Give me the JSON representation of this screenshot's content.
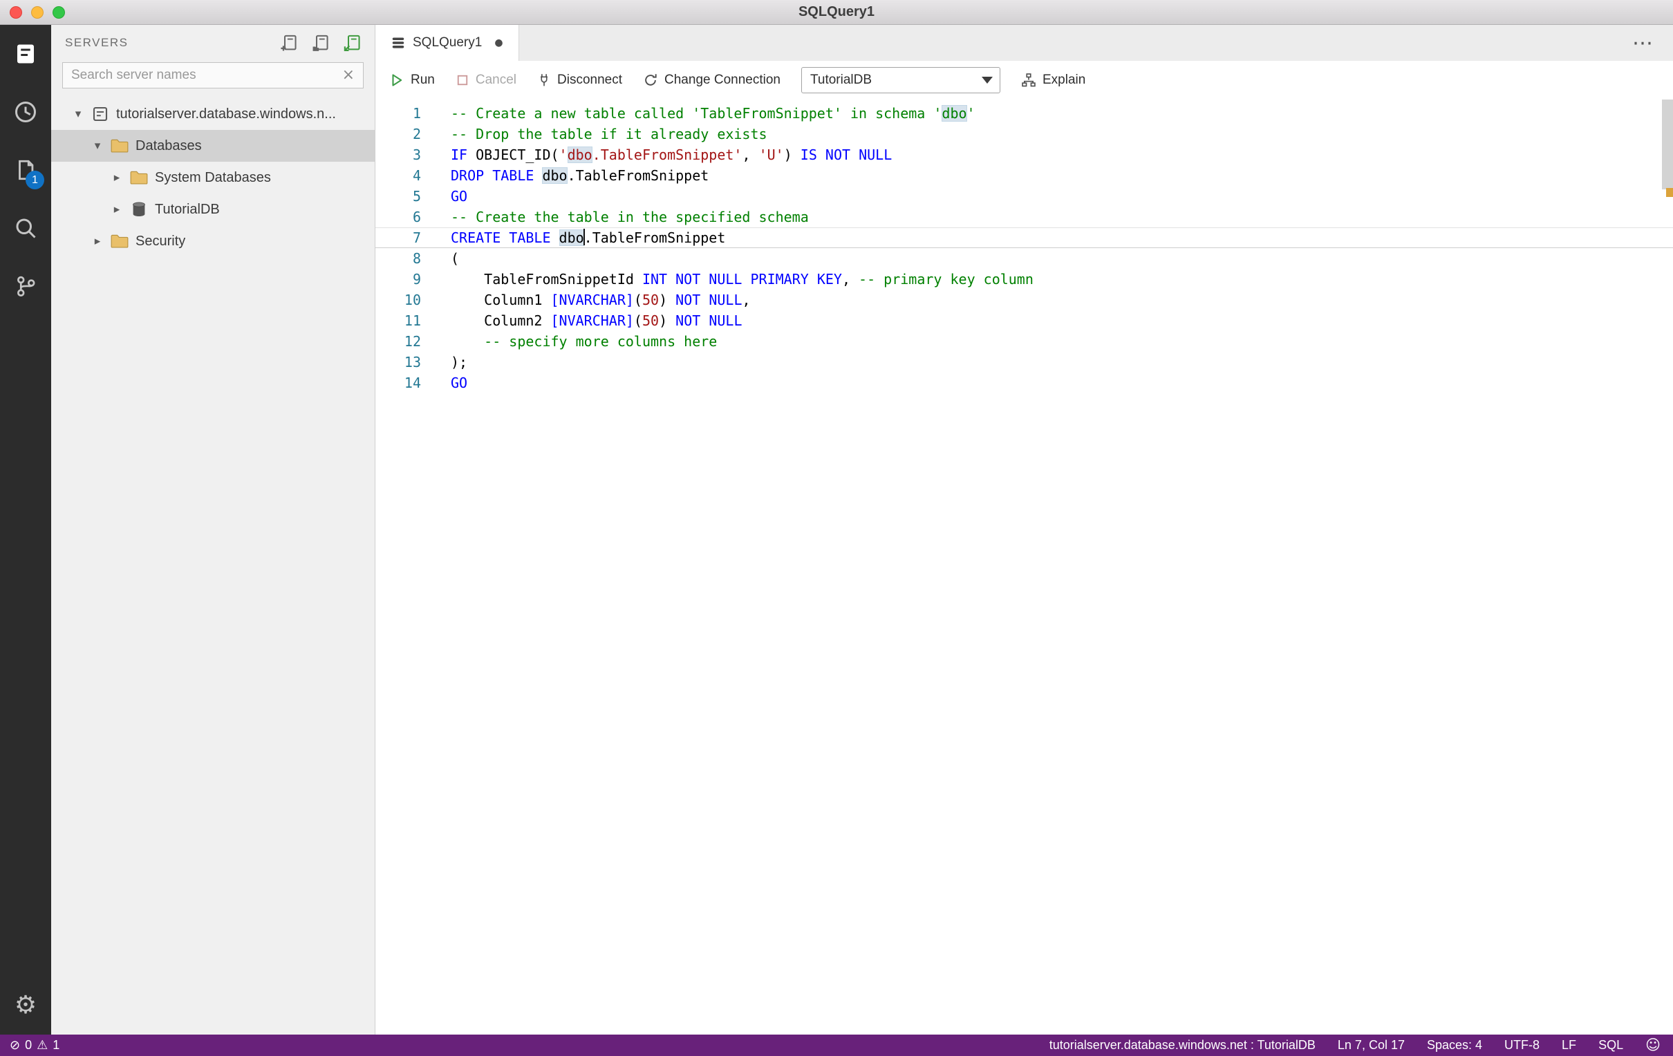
{
  "titlebar": {
    "title": "SQLQuery1"
  },
  "activity_bar": {
    "editors_badge": "1"
  },
  "icons": {
    "dirty_dot": "●",
    "more_actions": "⋯",
    "clear_search": "×",
    "error": "⊘",
    "warning": "⚠",
    "smiley": "☺",
    "gear": "⚙"
  },
  "sidebar": {
    "header": "SERVERS",
    "search_placeholder": "Search server names",
    "tree": [
      {
        "label": "tutorialserver.database.windows.n...",
        "level": 0,
        "state": "expanded",
        "icon": "server-icon",
        "selected": false
      },
      {
        "label": "Databases",
        "level": 1,
        "state": "expanded",
        "icon": "folder-icon",
        "selected": true
      },
      {
        "label": "System Databases",
        "level": 2,
        "state": "collapsed",
        "icon": "folder-icon",
        "selected": false
      },
      {
        "label": "TutorialDB",
        "level": 2,
        "state": "collapsed",
        "icon": "database-icon",
        "selected": false
      },
      {
        "label": "Security",
        "level": 1,
        "state": "collapsed",
        "icon": "folder-icon",
        "selected": false
      }
    ]
  },
  "editor": {
    "tab": {
      "label": "SQLQuery1",
      "dirty": true
    },
    "toolbar": {
      "run": "Run",
      "cancel": "Cancel",
      "disconnect": "Disconnect",
      "change_connection": "Change Connection",
      "database": "TutorialDB",
      "explain": "Explain"
    },
    "code": {
      "lines": [
        {
          "n": "1",
          "tokens": [
            {
              "t": "-- Create a new table called 'TableFromSnippet' in schema '",
              "c": "cm"
            },
            {
              "t": "dbo",
              "c": "cm hl"
            },
            {
              "t": "'",
              "c": "cm"
            }
          ]
        },
        {
          "n": "2",
          "tokens": [
            {
              "t": "-- Drop the table if it already exists",
              "c": "cm"
            }
          ]
        },
        {
          "n": "3",
          "tokens": [
            {
              "t": "IF",
              "c": "kw"
            },
            {
              "t": " OBJECT_ID(",
              "c": "pl"
            },
            {
              "t": "'",
              "c": "str"
            },
            {
              "t": "dbo",
              "c": "str hl"
            },
            {
              "t": ".TableFromSnippet'",
              "c": "str"
            },
            {
              "t": ", ",
              "c": "pl"
            },
            {
              "t": "'U'",
              "c": "str"
            },
            {
              "t": ") ",
              "c": "pl"
            },
            {
              "t": "IS NOT NULL",
              "c": "kw"
            }
          ]
        },
        {
          "n": "4",
          "tokens": [
            {
              "t": "DROP TABLE",
              "c": "kw"
            },
            {
              "t": " ",
              "c": "pl"
            },
            {
              "t": "dbo",
              "c": "pl hl"
            },
            {
              "t": ".TableFromSnippet",
              "c": "pl"
            }
          ]
        },
        {
          "n": "5",
          "tokens": [
            {
              "t": "GO",
              "c": "kw"
            }
          ]
        },
        {
          "n": "6",
          "tokens": [
            {
              "t": "-- Create the table in the specified schema",
              "c": "cm"
            }
          ]
        },
        {
          "n": "7",
          "current": true,
          "tokens": [
            {
              "t": "CREATE TABLE",
              "c": "kw"
            },
            {
              "t": " ",
              "c": "pl"
            },
            {
              "t": "dbo",
              "c": "pl hl"
            },
            {
              "cursor": true
            },
            {
              "t": ".TableFromSnippet",
              "c": "pl"
            }
          ]
        },
        {
          "n": "8",
          "tokens": [
            {
              "t": "(",
              "c": "pl"
            }
          ]
        },
        {
          "n": "9",
          "tokens": [
            {
              "t": "    TableFromSnippetId ",
              "c": "pl"
            },
            {
              "t": "INT NOT NULL PRIMARY KEY",
              "c": "kw"
            },
            {
              "t": ", ",
              "c": "pl"
            },
            {
              "t": "-- primary key column",
              "c": "cm"
            }
          ]
        },
        {
          "n": "10",
          "tokens": [
            {
              "t": "    Column1 ",
              "c": "pl"
            },
            {
              "t": "[NVARCHAR]",
              "c": "kw"
            },
            {
              "t": "(",
              "c": "pl"
            },
            {
              "t": "50",
              "c": "num"
            },
            {
              "t": ") ",
              "c": "pl"
            },
            {
              "t": "NOT NULL",
              "c": "kw"
            },
            {
              "t": ",",
              "c": "pl"
            }
          ]
        },
        {
          "n": "11",
          "tokens": [
            {
              "t": "    Column2 ",
              "c": "pl"
            },
            {
              "t": "[NVARCHAR]",
              "c": "kw"
            },
            {
              "t": "(",
              "c": "pl"
            },
            {
              "t": "50",
              "c": "num"
            },
            {
              "t": ") ",
              "c": "pl"
            },
            {
              "t": "NOT NULL",
              "c": "kw"
            }
          ]
        },
        {
          "n": "12",
          "tokens": [
            {
              "t": "    ",
              "c": "pl"
            },
            {
              "t": "-- specify more columns here",
              "c": "cm"
            }
          ]
        },
        {
          "n": "13",
          "tokens": [
            {
              "t": ");",
              "c": "pl"
            }
          ]
        },
        {
          "n": "14",
          "tokens": [
            {
              "t": "GO",
              "c": "kw"
            }
          ]
        }
      ]
    }
  },
  "status_bar": {
    "errors": "0",
    "warnings": "1",
    "connection": "tutorialserver.database.windows.net : TutorialDB",
    "position": "Ln 7, Col 17",
    "indent": "Spaces: 4",
    "encoding": "UTF-8",
    "eol": "LF",
    "language": "SQL"
  }
}
